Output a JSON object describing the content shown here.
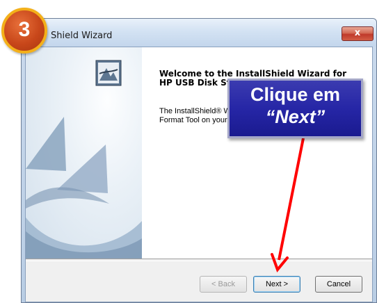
{
  "window": {
    "title": "Shield Wizard",
    "close_symbol": "x"
  },
  "content": {
    "welcome_heading": "Welcome to the InstallShield Wizard for HP USB Disk Storage Format Tool",
    "description": "The InstallShield® Wizard will install HP USB Disk Storage Format Tool on your computer. To continue, click Next."
  },
  "buttons": {
    "back": "< Back",
    "next": "Next >",
    "cancel": "Cancel"
  },
  "annotation": {
    "step_number": "3",
    "callout_line1": "Clique em",
    "callout_line2": "“Next”",
    "arrow_color": "#ff0000",
    "callout_color": "#2626a6",
    "badge_color": "#c8471a"
  },
  "icons": {
    "wizard_logo": "installshield-logo-icon",
    "close": "close-icon"
  }
}
